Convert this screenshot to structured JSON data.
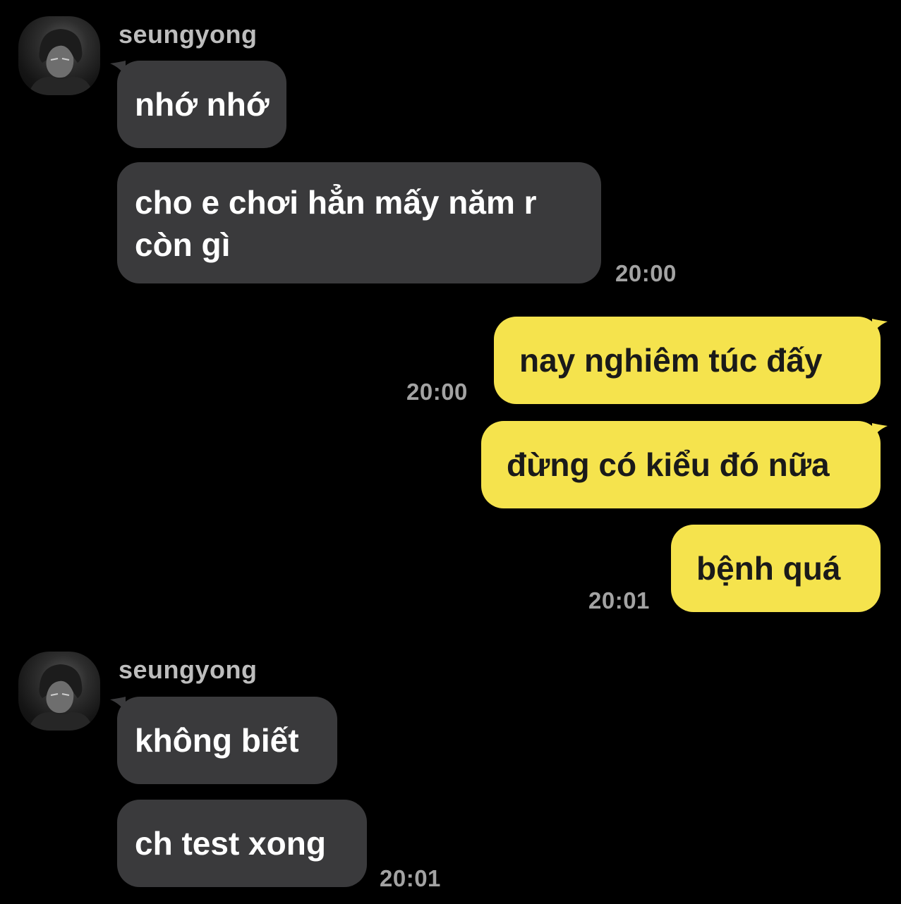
{
  "colors": {
    "background": "#000000",
    "incoming_bubble": "#3a3a3c",
    "outgoing_bubble": "#f5e34d",
    "timestamp": "#a3a3a3",
    "sender_name": "#bdbdbd"
  },
  "groups": [
    {
      "sender": "seungyong",
      "avatar": "profile-photo",
      "messages": [
        {
          "text": "nhớ nhớ"
        },
        {
          "text": "cho e chơi hẳn mấy năm r còn gì"
        }
      ],
      "time": "20:00"
    },
    {
      "sender": "me",
      "messages": [
        {
          "text": "nay nghiêm túc đấy",
          "time": "20:00"
        },
        {
          "text": "đừng có kiểu đó nữa"
        },
        {
          "text": "bệnh quá",
          "time": "20:01"
        }
      ]
    },
    {
      "sender": "seungyong",
      "avatar": "profile-photo",
      "messages": [
        {
          "text": "không biết"
        },
        {
          "text": "ch test xong"
        }
      ],
      "time": "20:01"
    }
  ]
}
